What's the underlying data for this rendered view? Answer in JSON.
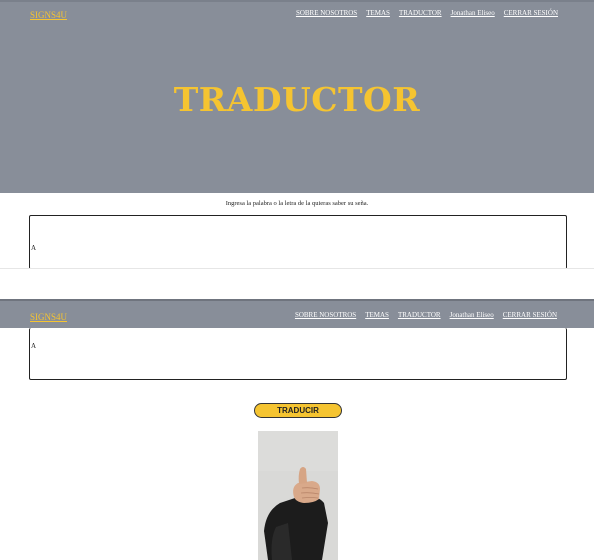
{
  "nav": {
    "brand": "SIGNS4U",
    "links": [
      "SOBRE NOSOTROS",
      "TEMAS",
      "TRADUCTOR",
      "Jonathan Eliseo",
      "CERRAR SESIÓN"
    ]
  },
  "hero": {
    "title": "TRADUCTOR"
  },
  "translator": {
    "instructions": "Ingresa la palabra o la letra de la quieras saber su seña.",
    "input_value": "A",
    "button_label": "TRADUCIR",
    "result_image_icon": "hand-sign-a-photo"
  },
  "colors": {
    "navbar": "#888e99",
    "accent": "#f5c431",
    "nav_link": "#ffffff"
  }
}
